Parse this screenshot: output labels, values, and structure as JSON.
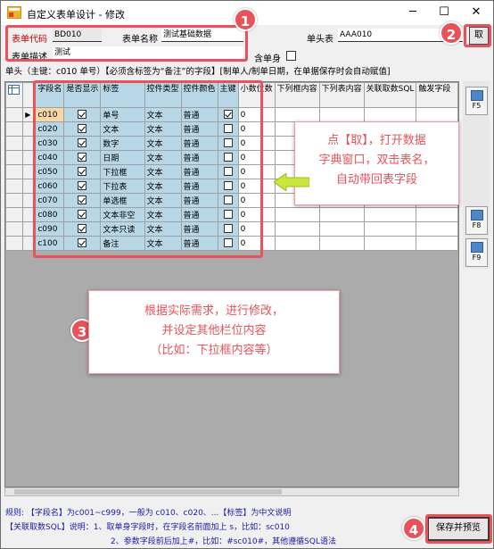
{
  "window": {
    "title": "自定义表单设计 - 修改",
    "controls": {
      "minimize": "─",
      "maximize": "☐",
      "close": "✕"
    }
  },
  "header": {
    "form_code_label": "表单代码",
    "form_code_value": "BD010",
    "form_name_label": "表单名称",
    "form_name_value": "测试基础数据",
    "form_desc_label": "表单描述",
    "form_desc_value": "测试",
    "single_label": "含单身",
    "single_checked": false,
    "head_table_label": "单头表",
    "head_table_value": "AAA010",
    "fetch_button": "取"
  },
  "info_line": "单头（主键：c010 单号）【必须含标签为“备注”的字段】[制单人/制单日期，在单据保存时会自动赋值]",
  "grid": {
    "columns": [
      "字段名",
      "是否显示",
      "标签",
      "控件类型",
      "控件颜色",
      "主键",
      "小数位数",
      "下列框内容",
      "下列表内容",
      "关联取数SQL",
      "触发字段"
    ],
    "rows": [
      {
        "field": "c010",
        "show": true,
        "label": "单号",
        "ctype": "文本",
        "color": "普通",
        "pk": true,
        "dec": "0"
      },
      {
        "field": "c020",
        "show": true,
        "label": "文本",
        "ctype": "文本",
        "color": "普通",
        "pk": false,
        "dec": "0"
      },
      {
        "field": "c030",
        "show": true,
        "label": "数字",
        "ctype": "文本",
        "color": "普通",
        "pk": false,
        "dec": "0"
      },
      {
        "field": "c040",
        "show": true,
        "label": "日期",
        "ctype": "文本",
        "color": "普通",
        "pk": false,
        "dec": "0"
      },
      {
        "field": "c050",
        "show": true,
        "label": "下拉框",
        "ctype": "文本",
        "color": "普通",
        "pk": false,
        "dec": "0"
      },
      {
        "field": "c060",
        "show": true,
        "label": "下拉表",
        "ctype": "文本",
        "color": "普通",
        "pk": false,
        "dec": "0"
      },
      {
        "field": "c070",
        "show": true,
        "label": "单选框",
        "ctype": "文本",
        "color": "普通",
        "pk": false,
        "dec": "0"
      },
      {
        "field": "c080",
        "show": true,
        "label": "文本非空",
        "ctype": "文本",
        "color": "普通",
        "pk": false,
        "dec": "0"
      },
      {
        "field": "c090",
        "show": true,
        "label": "文本只读",
        "ctype": "文本",
        "color": "普通",
        "pk": false,
        "dec": "0"
      },
      {
        "field": "c100",
        "show": true,
        "label": "备注",
        "ctype": "文本",
        "color": "普通",
        "pk": false,
        "dec": "0"
      }
    ]
  },
  "side_buttons": [
    "F5",
    "F8",
    "F9"
  ],
  "rules": [
    "规则: 【字段名】为c001~c999，一般为 c010、c020、...【标签】为中文说明",
    "【关联取数SQL】说明：1、取单身字段时，在字段名前面加上 s，比如：sc010",
    "2、参数字段前后加上#，比如：#sc010#，其他遵循SQL语法"
  ],
  "save_button": "保存并预览",
  "annotations": {
    "badges": [
      "1",
      "2",
      "3",
      "4"
    ],
    "callout_fetch": [
      "点【取】，打开数据",
      "字典窗口，双击表名，",
      "自动带回表字段"
    ],
    "callout_modify": [
      "根据实际需求，进行修改，",
      "并设定其他栏位内容",
      "（比如：下拉框内容等）"
    ],
    "accent_color": "#e8525a",
    "arrow_color": "#c8e63c"
  }
}
